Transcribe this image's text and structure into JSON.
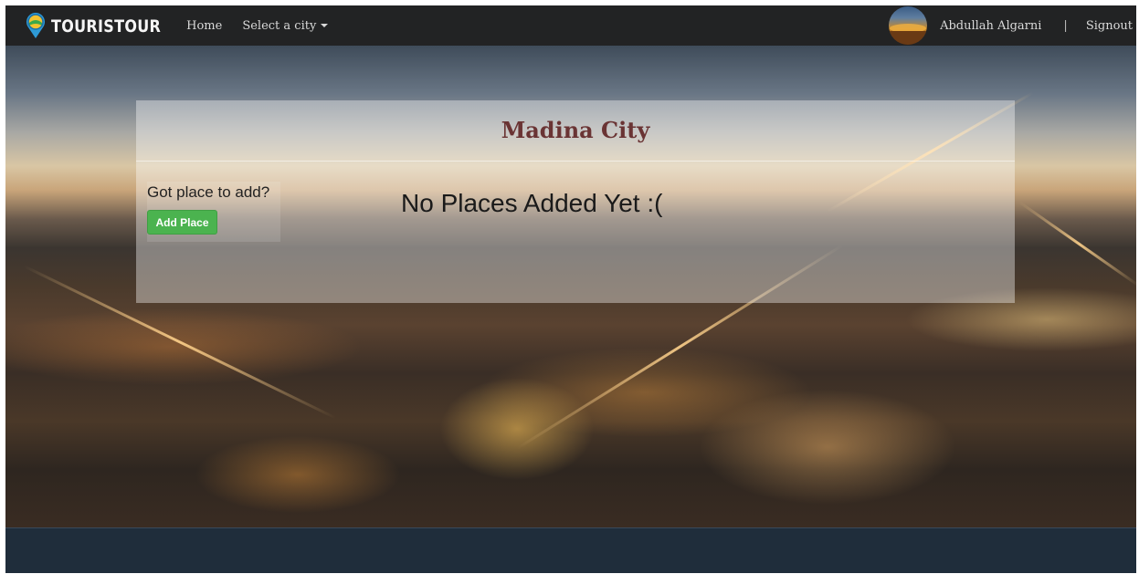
{
  "navbar": {
    "brand": "TOURISTOUR",
    "brand_icon": "map-pin-globe-icon",
    "links": [
      {
        "label": "Home"
      },
      {
        "label": "Select a city",
        "has_caret": true
      }
    ],
    "user_name": "Abdullah Algarni",
    "separator": "|",
    "signout_label": "Signout"
  },
  "main": {
    "city_title": "Madina City",
    "add_prompt": "Got place to add?",
    "add_button_label": "Add Place",
    "empty_message": "No Places Added Yet :("
  },
  "colors": {
    "navbar_bg": "#222324",
    "footer_bg": "#1f2d3b",
    "title_color": "#6a3434",
    "button_green": "#4bb34f"
  }
}
